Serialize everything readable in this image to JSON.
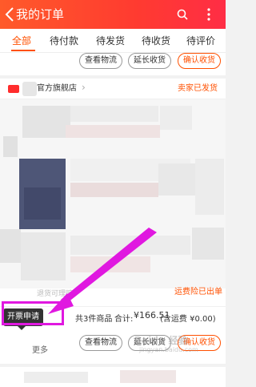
{
  "header": {
    "title": "我的订单",
    "back_icon": "chevron-left-icon",
    "search_icon": "search-icon",
    "more_icon": "more-vertical-icon",
    "colors": {
      "start": "#ff5a2a",
      "end": "#ff2d45"
    }
  },
  "tabs": [
    {
      "label": "全部",
      "active": true
    },
    {
      "label": "待付款",
      "active": false
    },
    {
      "label": "待发货",
      "active": false
    },
    {
      "label": "待收货",
      "active": false
    },
    {
      "label": "待评价",
      "active": false
    }
  ],
  "top_card": {
    "buttons": {
      "logistics": "查看物流",
      "extend": "延长收货",
      "confirm": "确认收货"
    }
  },
  "order": {
    "shop_name": "官方旗舰店",
    "status": "卖家已发货",
    "insurance_label": "运费险已出单",
    "insurance_note": "退货可理赔",
    "summary": {
      "count": "共3件商品",
      "total_label": "合计:",
      "total": "¥166.51",
      "shipping": "(含运费 ¥0.00)"
    },
    "invoice_tip": "开票申请",
    "more": "更多",
    "buttons": {
      "logistics": "查看物流",
      "extend": "延长收货",
      "confirm": "确认收货"
    }
  },
  "watermark": {
    "brand": "Baidu 经验",
    "url": "jingyan.baidu.com"
  },
  "colors": {
    "accent": "#ff5000",
    "highlight": "#e018e0"
  }
}
